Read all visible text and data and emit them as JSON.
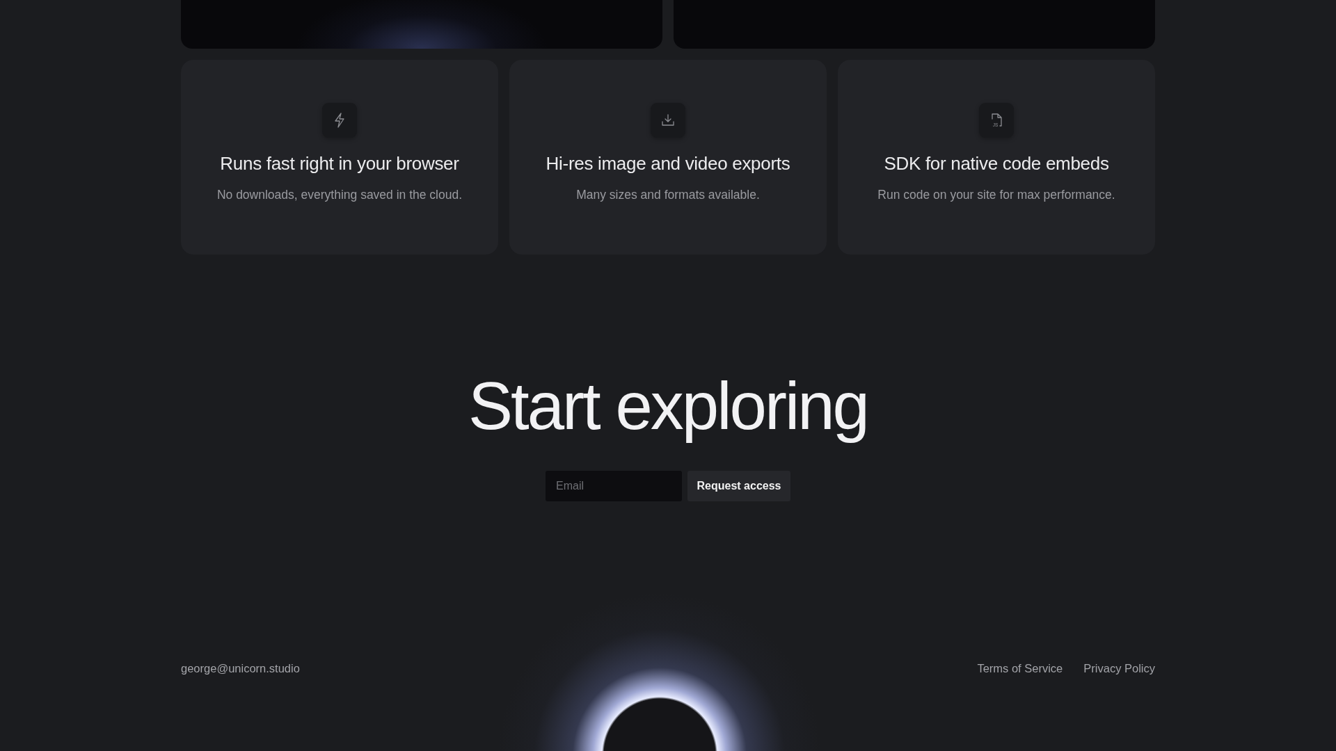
{
  "features": [
    {
      "kind": "bolt",
      "title": "Runs fast right in your browser",
      "description": "No downloads, everything saved in the cloud."
    },
    {
      "kind": "download",
      "title": "Hi-res image and video exports",
      "description": "Many sizes and formats available."
    },
    {
      "kind": "file",
      "icon_text": "JS",
      "title": "SDK for native code embeds",
      "description": "Run code on your site for max performance."
    }
  ],
  "cta": {
    "heading": "Start exploring",
    "email": {
      "placeholder": "Email"
    },
    "button": "Request access"
  },
  "footer": {
    "contact": "george@unicorn.studio",
    "links": [
      "Terms of Service",
      "Privacy Policy"
    ]
  }
}
